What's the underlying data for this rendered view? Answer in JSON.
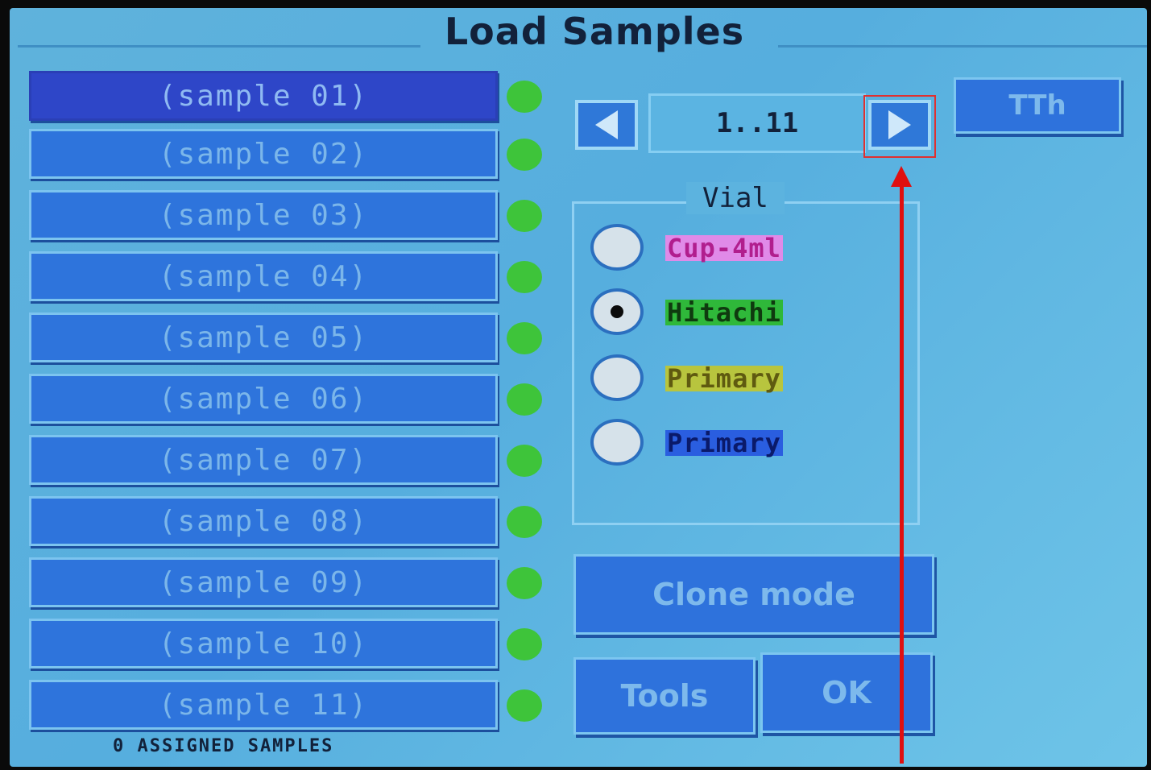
{
  "title": "Load Samples",
  "samples": [
    {
      "label": "(sample 01)"
    },
    {
      "label": "(sample 02)"
    },
    {
      "label": "(sample 03)"
    },
    {
      "label": "(sample 04)"
    },
    {
      "label": "(sample 05)"
    },
    {
      "label": "(sample 06)"
    },
    {
      "label": "(sample 07)"
    },
    {
      "label": "(sample 08)"
    },
    {
      "label": "(sample 09)"
    },
    {
      "label": "(sample 10)"
    },
    {
      "label": "(sample 11)"
    }
  ],
  "selected_sample_index": 0,
  "status_dot_color": "#3ec43a",
  "pager": {
    "range": "1..11",
    "prev_icon": "triangle-left-icon",
    "next_icon": "triangle-right-icon"
  },
  "tth_button": "TTh",
  "vial": {
    "label": "Vial",
    "options": [
      {
        "label": "Cup-4ml",
        "bg": "#e08ae8",
        "color": "#b11e8e",
        "selected": false
      },
      {
        "label": "Hitachi",
        "bg": "#2fb83a",
        "color": "#0f3a0f",
        "selected": true
      },
      {
        "label": "Primary",
        "bg": "#b8c53e",
        "color": "#5f5a10",
        "selected": false
      },
      {
        "label": "Primary",
        "bg": "#2a5ee0",
        "color": "#0a1a6a",
        "selected": false
      }
    ]
  },
  "buttons": {
    "clone_mode": "Clone mode",
    "tools": "Tools",
    "ok": "OK"
  },
  "status": "0 ASSIGNED SAMPLES",
  "annotation": {
    "highlight_color": "#e03030"
  }
}
